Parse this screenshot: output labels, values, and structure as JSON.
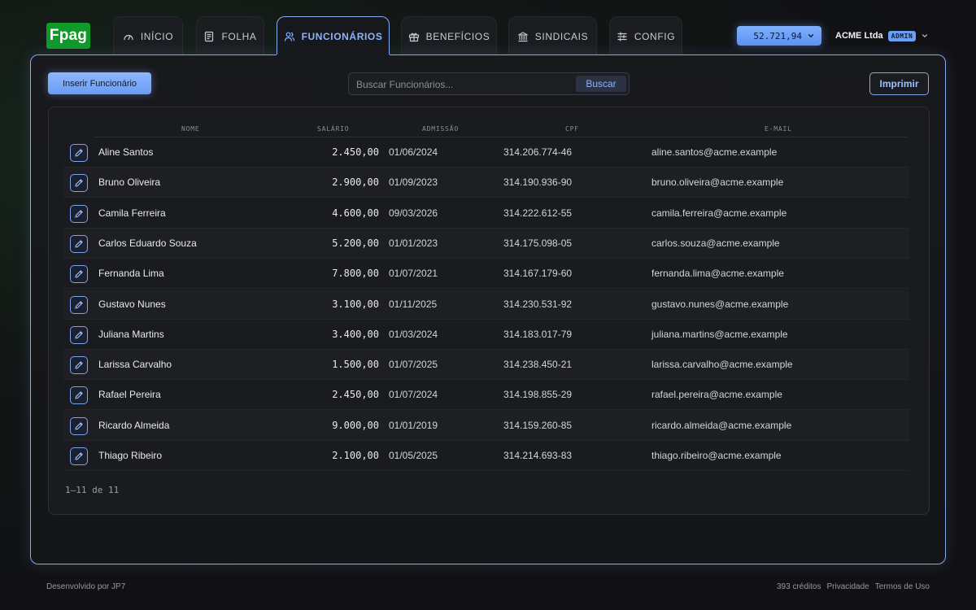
{
  "brand": {
    "logo_text": "Fpag",
    "logo_color": "#0f9a2a"
  },
  "nav": {
    "tabs": [
      {
        "label": "INÍCIO",
        "icon": "gauge-icon",
        "active": false
      },
      {
        "label": "FOLHA",
        "icon": "document-icon",
        "active": false
      },
      {
        "label": "FUNCIONÁRIOS",
        "icon": "users-icon",
        "active": true
      },
      {
        "label": "BENEFÍCIOS",
        "icon": "gift-icon",
        "active": false
      },
      {
        "label": "SINDICAIS",
        "icon": "bank-icon",
        "active": false
      },
      {
        "label": "CONFIG",
        "icon": "sliders-icon",
        "active": false
      }
    ]
  },
  "account": {
    "balance": "52.721,94",
    "company": "ACME Ltda",
    "role_badge": "ADMIN"
  },
  "toolbar": {
    "insert_label": "Inserir Funcionário",
    "search_placeholder": "Buscar Funcionários...",
    "search_button": "Buscar",
    "print_label": "Imprimir"
  },
  "table": {
    "headers": {
      "name": "NOME",
      "salary": "SALÁRIO",
      "admission": "ADMISSÃO",
      "cpf": "CPF",
      "email": "E-MAIL"
    },
    "rows": [
      {
        "name": "Aline Santos",
        "salary": "2.450,00",
        "admission": "01/06/2024",
        "cpf": "314.206.774-46",
        "email": "aline.santos@acme.example"
      },
      {
        "name": "Bruno Oliveira",
        "salary": "2.900,00",
        "admission": "01/09/2023",
        "cpf": "314.190.936-90",
        "email": "bruno.oliveira@acme.example"
      },
      {
        "name": "Camila Ferreira",
        "salary": "4.600,00",
        "admission": "09/03/2026",
        "cpf": "314.222.612-55",
        "email": "camila.ferreira@acme.example"
      },
      {
        "name": "Carlos Eduardo Souza",
        "salary": "5.200,00",
        "admission": "01/01/2023",
        "cpf": "314.175.098-05",
        "email": "carlos.souza@acme.example"
      },
      {
        "name": "Fernanda Lima",
        "salary": "7.800,00",
        "admission": "01/07/2021",
        "cpf": "314.167.179-60",
        "email": "fernanda.lima@acme.example"
      },
      {
        "name": "Gustavo Nunes",
        "salary": "3.100,00",
        "admission": "01/11/2025",
        "cpf": "314.230.531-92",
        "email": "gustavo.nunes@acme.example"
      },
      {
        "name": "Juliana Martins",
        "salary": "3.400,00",
        "admission": "01/03/2024",
        "cpf": "314.183.017-79",
        "email": "juliana.martins@acme.example"
      },
      {
        "name": "Larissa Carvalho",
        "salary": "1.500,00",
        "admission": "01/07/2025",
        "cpf": "314.238.450-21",
        "email": "larissa.carvalho@acme.example"
      },
      {
        "name": "Rafael Pereira",
        "salary": "2.450,00",
        "admission": "01/07/2024",
        "cpf": "314.198.855-29",
        "email": "rafael.pereira@acme.example"
      },
      {
        "name": "Ricardo Almeida",
        "salary": "9.000,00",
        "admission": "01/01/2019",
        "cpf": "314.159.260-85",
        "email": "ricardo.almeida@acme.example"
      },
      {
        "name": "Thiago Ribeiro",
        "salary": "2.100,00",
        "admission": "01/05/2025",
        "cpf": "314.214.693-83",
        "email": "thiago.ribeiro@acme.example"
      }
    ],
    "pagination": "1–11 de 11"
  },
  "footer": {
    "developer": "Desenvolvido por JP7",
    "credits": "393 créditos",
    "privacy": "Privacidade",
    "terms": "Termos de Uso"
  },
  "colors": {
    "accent": "#86a9ef",
    "accent_fill": "#6b9cf2"
  }
}
